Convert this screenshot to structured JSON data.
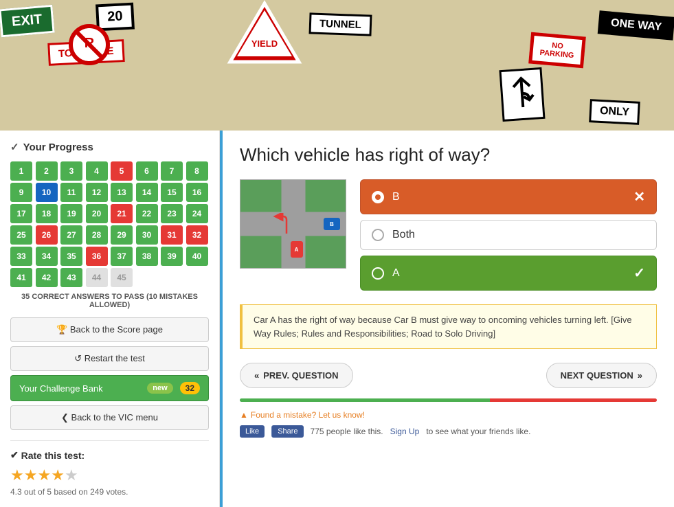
{
  "hero": {
    "alt": "Road signs collage"
  },
  "sidebar": {
    "progress_header": "Your Progress",
    "grid_cells": [
      {
        "num": 1,
        "type": "green"
      },
      {
        "num": 2,
        "type": "green"
      },
      {
        "num": 3,
        "type": "green"
      },
      {
        "num": 4,
        "type": "green"
      },
      {
        "num": 5,
        "type": "red"
      },
      {
        "num": 6,
        "type": "green"
      },
      {
        "num": 7,
        "type": "green"
      },
      {
        "num": 8,
        "type": "green"
      },
      {
        "num": 9,
        "type": "green"
      },
      {
        "num": 10,
        "type": "blue"
      },
      {
        "num": 11,
        "type": "green"
      },
      {
        "num": 12,
        "type": "green"
      },
      {
        "num": 13,
        "type": "green"
      },
      {
        "num": 14,
        "type": "green"
      },
      {
        "num": 15,
        "type": "green"
      },
      {
        "num": 16,
        "type": "green"
      },
      {
        "num": 17,
        "type": "green"
      },
      {
        "num": 18,
        "type": "green"
      },
      {
        "num": 19,
        "type": "green"
      },
      {
        "num": 20,
        "type": "green"
      },
      {
        "num": 21,
        "type": "red"
      },
      {
        "num": 22,
        "type": "green"
      },
      {
        "num": 23,
        "type": "green"
      },
      {
        "num": 24,
        "type": "green"
      },
      {
        "num": 25,
        "type": "green"
      },
      {
        "num": 26,
        "type": "red"
      },
      {
        "num": 27,
        "type": "green"
      },
      {
        "num": 28,
        "type": "green"
      },
      {
        "num": 29,
        "type": "green"
      },
      {
        "num": 30,
        "type": "green"
      },
      {
        "num": 31,
        "type": "red"
      },
      {
        "num": 32,
        "type": "red"
      },
      {
        "num": 33,
        "type": "green"
      },
      {
        "num": 34,
        "type": "green"
      },
      {
        "num": 35,
        "type": "green"
      },
      {
        "num": 36,
        "type": "red"
      },
      {
        "num": 37,
        "type": "green"
      },
      {
        "num": 38,
        "type": "green"
      },
      {
        "num": 39,
        "type": "green"
      },
      {
        "num": 40,
        "type": "green"
      },
      {
        "num": 41,
        "type": "green"
      },
      {
        "num": 42,
        "type": "green"
      },
      {
        "num": 43,
        "type": "green"
      },
      {
        "num": 44,
        "type": "light"
      },
      {
        "num": 45,
        "type": "light"
      }
    ],
    "pass_info": "35 correct answers to pass (10 mistakes allowed)",
    "back_score_label": "Back to the Score page",
    "restart_label": "Restart the test",
    "challenge_bank_label": "Your Challenge Bank",
    "challenge_badge_new": "new",
    "challenge_count": "32",
    "back_vic_label": "Back to the VIC menu",
    "rate_header": "Rate this test:",
    "rate_score": "4.3 out of 5 based on 249 votes."
  },
  "question": {
    "title": "Which vehicle has right of way?",
    "answer_b_label": "B",
    "answer_both_label": "Both",
    "answer_a_label": "A",
    "explanation": "Car A has the right of way because Car B must give way to oncoming vehicles turning left. [Give Way Rules; Rules and Responsibilities; Road to Solo Driving]",
    "prev_label": "PREV. QUESTION",
    "next_label": "NEXT QUESTION",
    "mistake_label": "Found a mistake? Let us know!",
    "social_text": "775 people like this.",
    "social_signup": "Sign Up",
    "social_suffix": "to see what your friends like.",
    "like_label": "Like",
    "share_label": "Share"
  },
  "colors": {
    "wrong": "#d85c28",
    "correct": "#5a9e2f",
    "blue_accent": "#3b9fd6",
    "star_color": "#f5a623"
  }
}
